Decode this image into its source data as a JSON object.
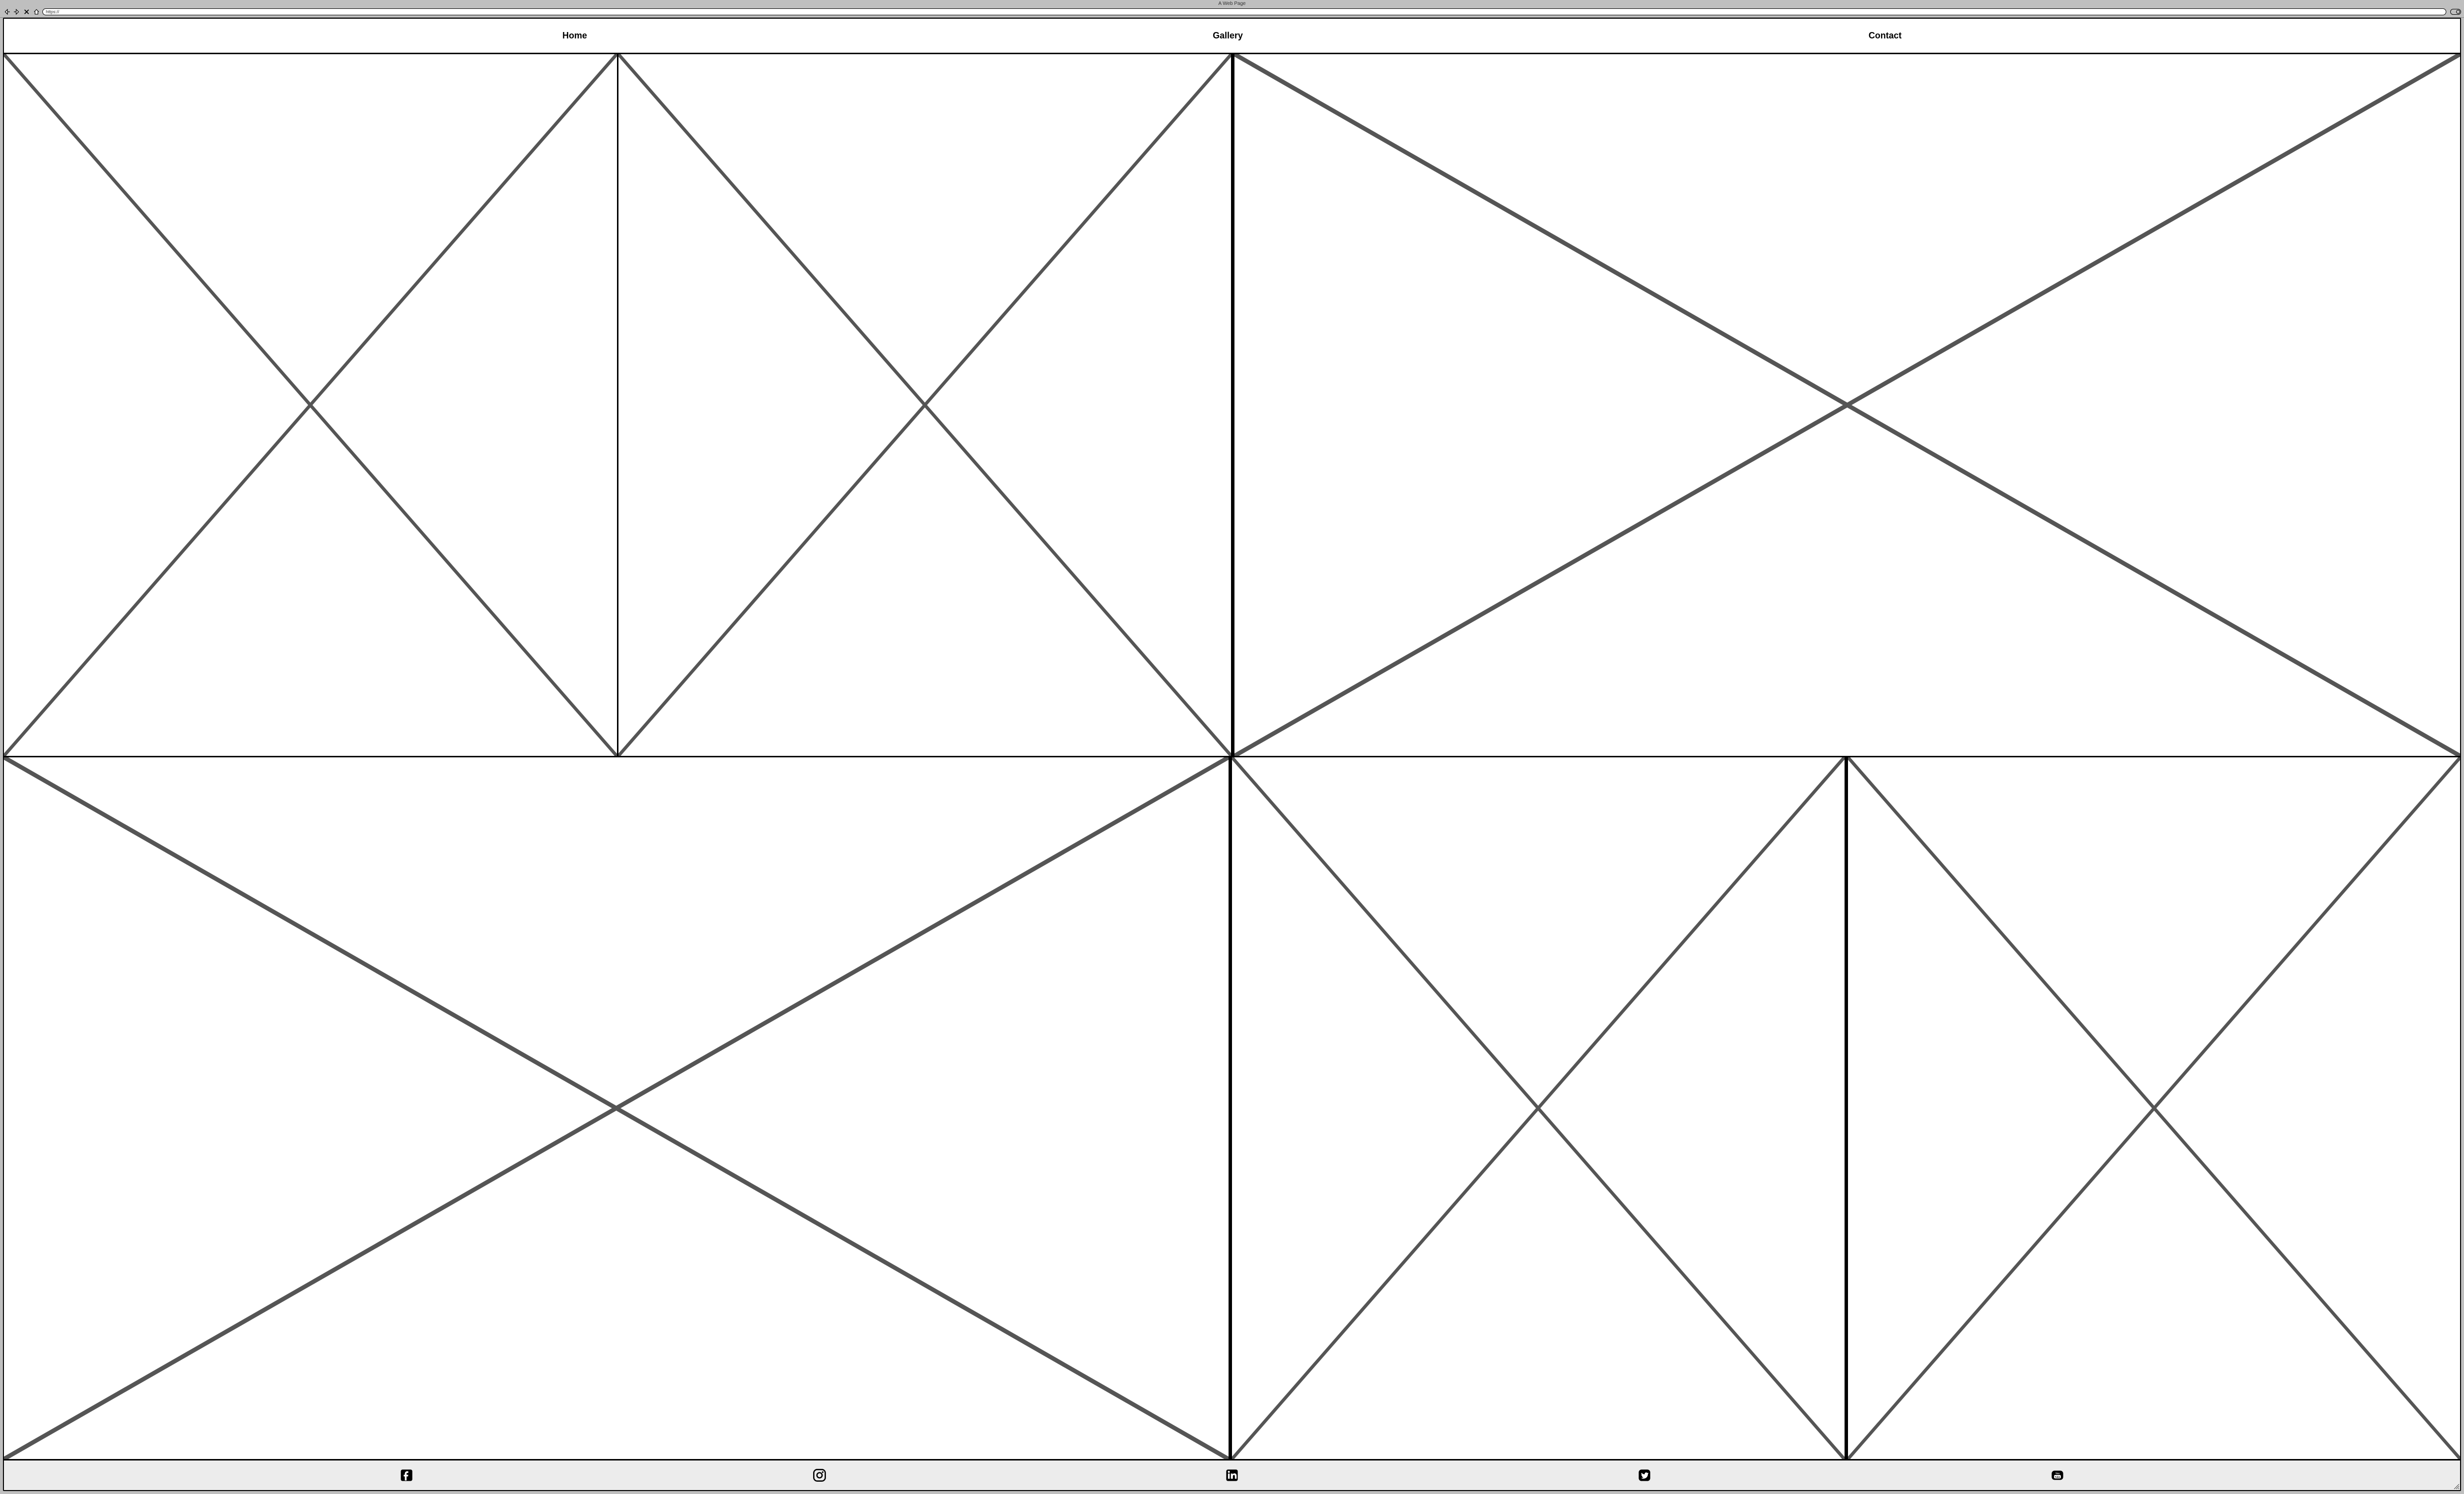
{
  "browser": {
    "title": "A Web Page",
    "url": "https://"
  },
  "nav": {
    "home": "Home",
    "gallery": "Gallery",
    "contact": "Contact"
  },
  "icons": {
    "back": "back-arrow",
    "forward": "forward-arrow",
    "stop": "stop-x",
    "home": "home-outline",
    "facebook": "facebook",
    "instagram": "instagram",
    "linkedin": "linkedin",
    "twitter": "twitter",
    "youtube": "youtube"
  }
}
